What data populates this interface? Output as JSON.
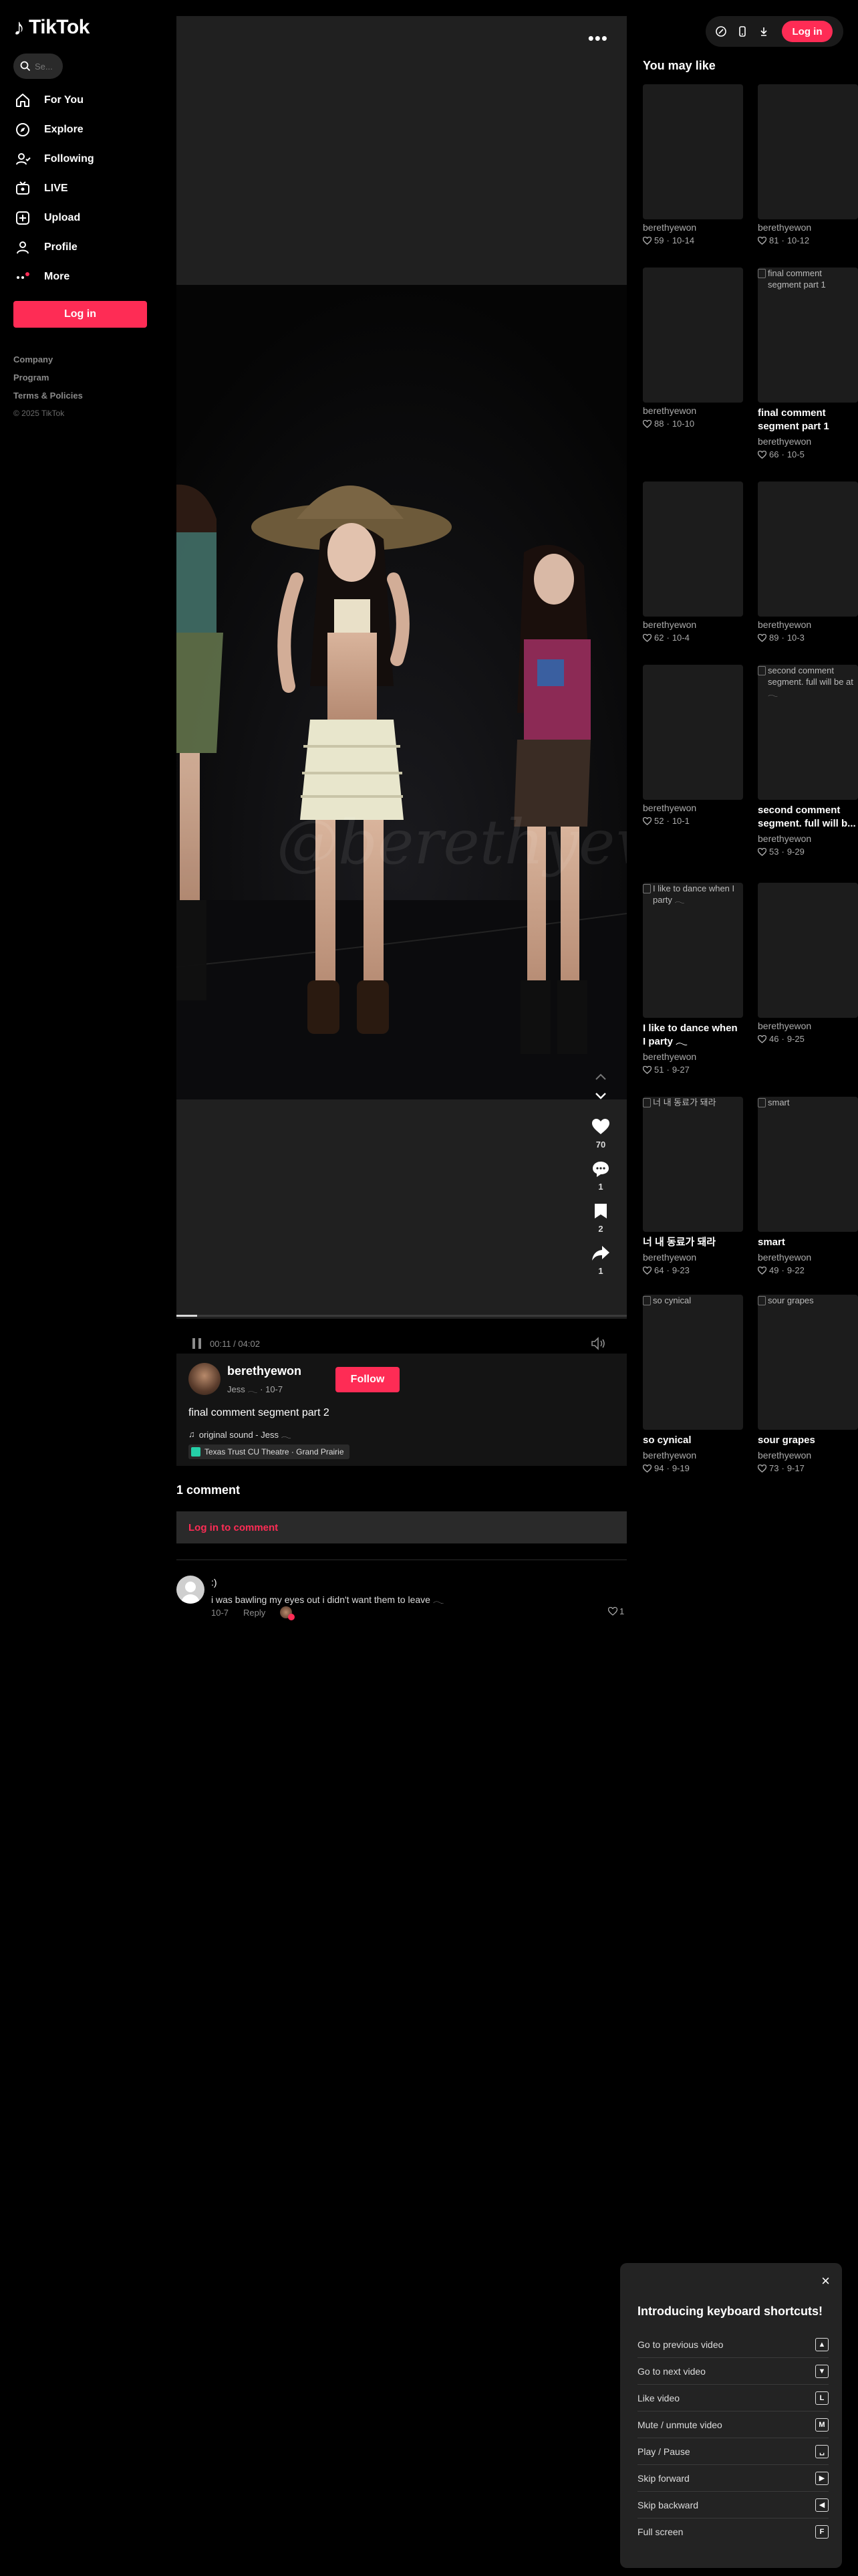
{
  "app": {
    "logo_text": "TikTok"
  },
  "search": {
    "placeholder": "Se..."
  },
  "nav": [
    {
      "label": "For You",
      "icon": "home-icon"
    },
    {
      "label": "Explore",
      "icon": "compass-icon"
    },
    {
      "label": "Following",
      "icon": "following-icon"
    },
    {
      "label": "LIVE",
      "icon": "live-icon"
    },
    {
      "label": "Upload",
      "icon": "upload-icon"
    },
    {
      "label": "Profile",
      "icon": "profile-icon"
    },
    {
      "label": "More",
      "icon": "more-icon"
    }
  ],
  "sidebar": {
    "login_label": "Log in"
  },
  "footer": {
    "company": "Company",
    "program": "Program",
    "terms": "Terms & Policies",
    "copyright": "© 2025 TikTok"
  },
  "topbar": {
    "login_label": "Log in"
  },
  "video": {
    "more": "•••",
    "watermark": "@berethyewon",
    "time": "00:11 / 04:02",
    "progress": 0.046,
    "likes": "70",
    "comments": "1",
    "saves": "2",
    "shares": "1"
  },
  "author": {
    "username": "berethyewon",
    "subname": "Jess 𓂃 · 10-7",
    "follow_label": "Follow",
    "caption": "final comment segment part 2",
    "sound": "original sound - Jess 𓂃",
    "location": "Texas Trust CU Theatre · Grand Prairie"
  },
  "comments": {
    "heading": "1 comment",
    "login_prompt": "Log in to comment",
    "items": [
      {
        "user": ":)",
        "text": "i was bawling my eyes out i didn't want them to leave 𓂃",
        "date": "10-7",
        "reply": "Reply",
        "likes": "1"
      }
    ]
  },
  "recommended": {
    "heading": "You may like",
    "cards": [
      {
        "alt": "",
        "title": "",
        "user": "berethyewon",
        "likes": "59",
        "date": "10-14"
      },
      {
        "alt": "",
        "title": "",
        "user": "berethyewon",
        "likes": "81",
        "date": "10-12"
      },
      {
        "alt": "",
        "title": "",
        "user": "berethyewon",
        "likes": "88",
        "date": "10-10"
      },
      {
        "alt": "final comment segment part 1",
        "title": "final comment segment part 1",
        "user": "berethyewon",
        "likes": "66",
        "date": "10-5"
      },
      {
        "alt": "",
        "title": "",
        "user": "berethyewon",
        "likes": "62",
        "date": "10-4"
      },
      {
        "alt": "",
        "title": "",
        "user": "berethyewon",
        "likes": "89",
        "date": "10-3"
      },
      {
        "alt": "",
        "title": "",
        "user": "berethyewon",
        "likes": "52",
        "date": "10-1"
      },
      {
        "alt": "second comment segment. full will be at 𓂃",
        "title": "second comment segment. full will b...",
        "user": "berethyewon",
        "likes": "53",
        "date": "9-29"
      },
      {
        "alt": "I like to dance when I party 𓂃",
        "title": "I like to dance when I party 𓂃",
        "user": "berethyewon",
        "likes": "51",
        "date": "9-27"
      },
      {
        "alt": "",
        "title": "",
        "user": "berethyewon",
        "likes": "46",
        "date": "9-25"
      },
      {
        "alt": "너 내 동료가 돼라",
        "title": "너 내 동료가 돼라",
        "user": "berethyewon",
        "likes": "64",
        "date": "9-23"
      },
      {
        "alt": "smart",
        "title": "smart",
        "user": "berethyewon",
        "likes": "49",
        "date": "9-22"
      },
      {
        "alt": "so cynical",
        "title": "so cynical",
        "user": "berethyewon",
        "likes": "94",
        "date": "9-19"
      },
      {
        "alt": "sour grapes",
        "title": "sour grapes",
        "user": "berethyewon",
        "likes": "73",
        "date": "9-17"
      }
    ]
  },
  "shortcuts": {
    "title": "Introducing keyboard shortcuts!",
    "close": "×",
    "items": [
      {
        "label": "Go to previous video",
        "key": "▲"
      },
      {
        "label": "Go to next video",
        "key": "▼"
      },
      {
        "label": "Like video",
        "key": "L"
      },
      {
        "label": "Mute / unmute video",
        "key": "M"
      },
      {
        "label": "Play / Pause",
        "key": "␣"
      },
      {
        "label": "Skip forward",
        "key": "▶"
      },
      {
        "label": "Skip backward",
        "key": "◀"
      },
      {
        "label": "Full screen",
        "key": "F"
      }
    ]
  }
}
